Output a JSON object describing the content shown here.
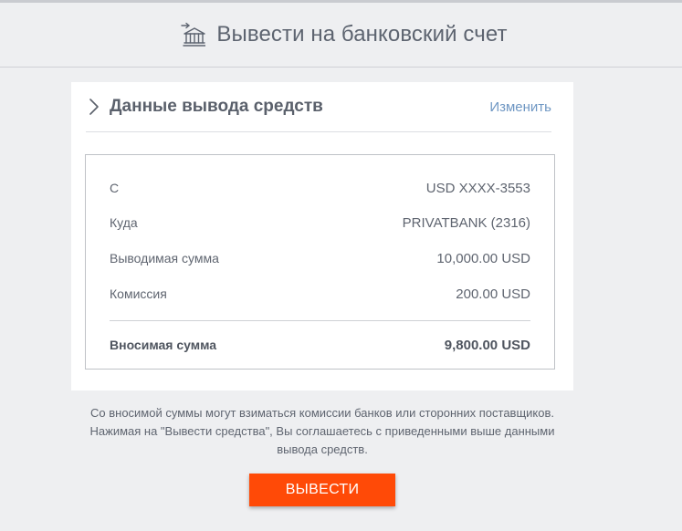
{
  "header": {
    "title": "Вывести на банковский счет",
    "icon": "bank-withdraw-icon"
  },
  "card": {
    "title": "Данные вывода средств",
    "edit_label": "Изменить",
    "rows": [
      {
        "label": "С",
        "value": "USD XXXX-3553"
      },
      {
        "label": "Куда",
        "value": "PRIVATBANK (2316)"
      },
      {
        "label": "Выводимая сумма",
        "value": "10,000.00 USD"
      },
      {
        "label": "Комиссия",
        "value": "200.00 USD"
      }
    ],
    "total": {
      "label": "Вносимая сумма",
      "value": "9,800.00 USD"
    }
  },
  "disclaimer": {
    "line1": "Со вносимой суммы могут взиматься комиссии банков или сторонних поставщиков.",
    "line2": "Нажимая на \"Вывести средства\", Вы соглашаетесь с приведенными выше данными",
    "line3": "вывода средств."
  },
  "actions": {
    "withdraw_label": "ВЫВЕСТИ"
  },
  "colors": {
    "accent": "#ff4a07",
    "link": "#6f97c3",
    "background": "#eeeff1"
  }
}
